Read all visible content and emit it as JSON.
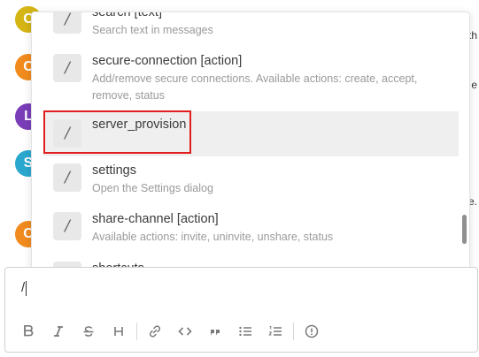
{
  "background_chat": {
    "avatars": [
      {
        "initial": "C",
        "color": "#d5b515"
      },
      {
        "initial": "C",
        "color": "#f18b1e"
      },
      {
        "initial": "L",
        "color": "#7a3db8"
      },
      {
        "initial": "S",
        "color": "#2aa7cf"
      },
      {
        "initial": "C",
        "color": "#f18b1e"
      }
    ],
    "edge_text": [
      "th",
      "e",
      "e."
    ]
  },
  "commands": [
    {
      "name": "search [text]",
      "description": "Search text in messages"
    },
    {
      "name": "secure-connection [action]",
      "description": "Add/remove secure connections. Available actions: create, accept, remove, status"
    },
    {
      "name": "server_provision",
      "description": ""
    },
    {
      "name": "settings",
      "description": "Open the Settings dialog"
    },
    {
      "name": "share-channel [action]",
      "description": "Available actions: invite, uninvite, unshare, status"
    },
    {
      "name": "shortcuts",
      "description": ""
    }
  ],
  "slash_glyph": "/",
  "composer": {
    "value": "/"
  },
  "colors": {
    "highlight": "#e01e1e",
    "active_row": "#efefef"
  }
}
